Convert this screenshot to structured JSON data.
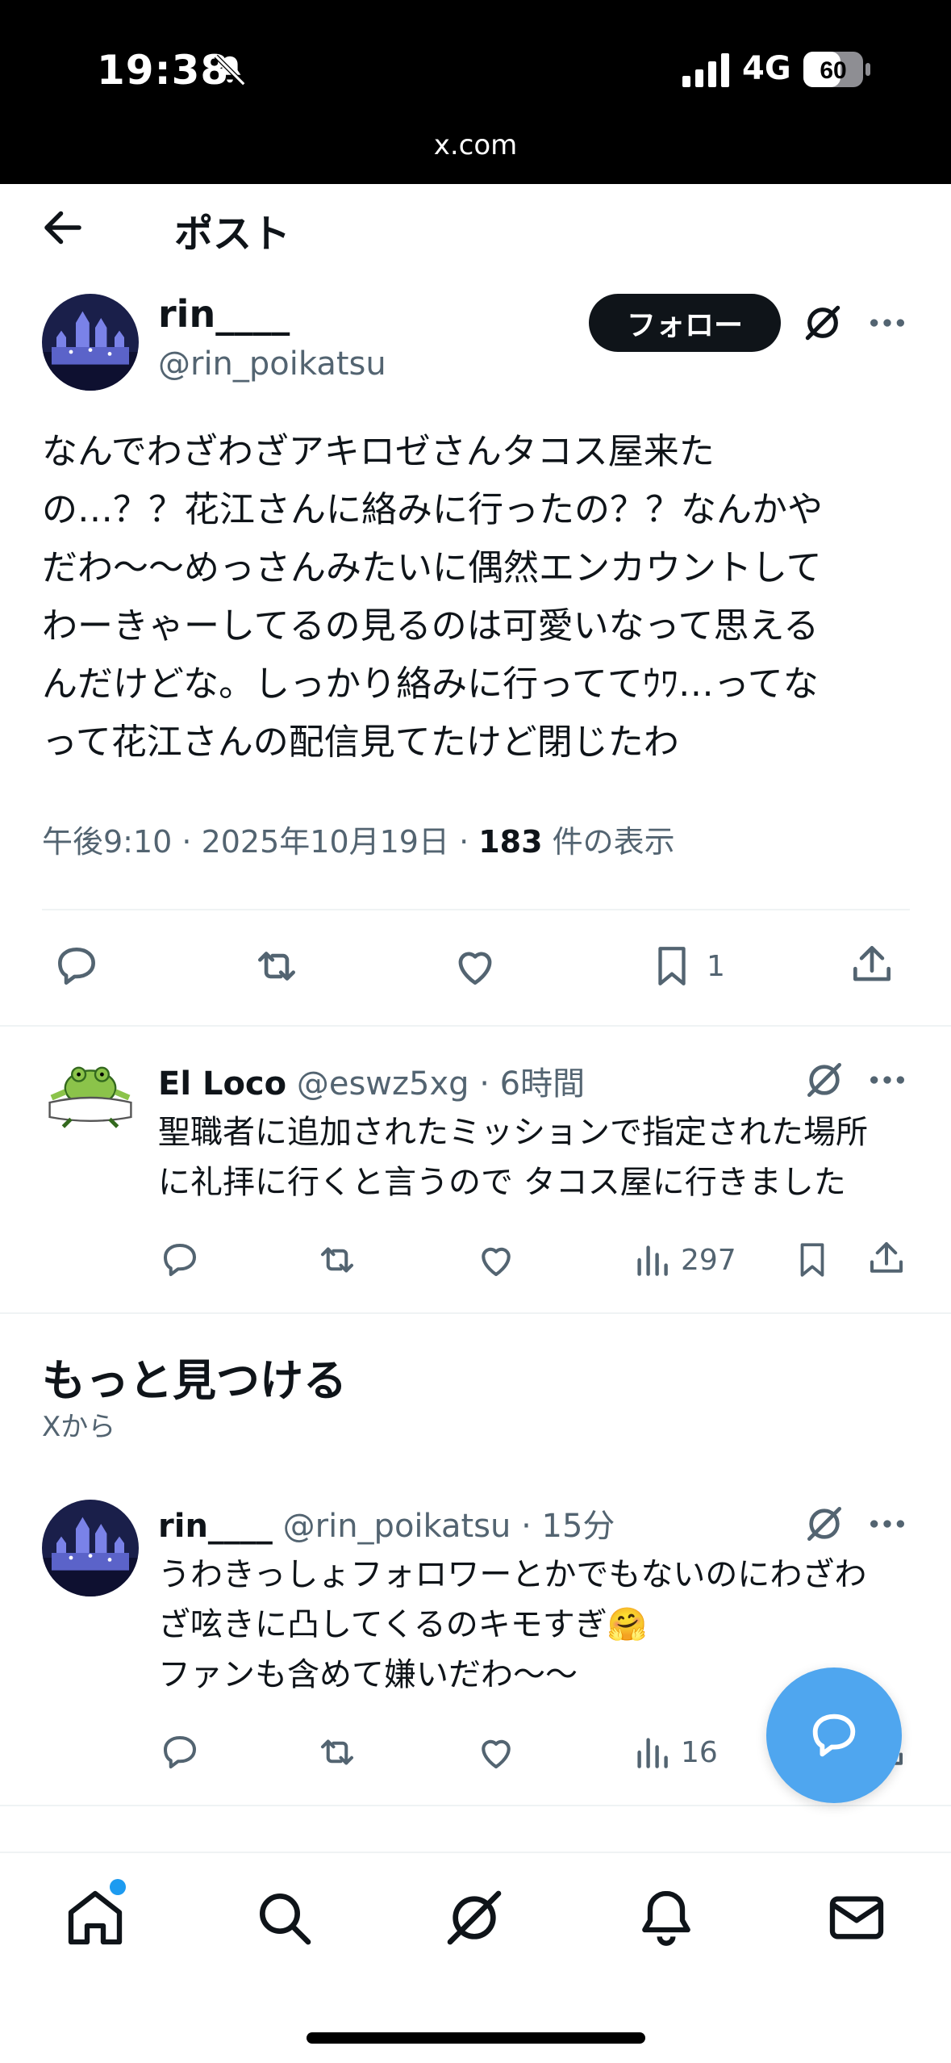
{
  "status_bar": {
    "time": "19:38",
    "network": "4G",
    "battery": "60",
    "url": "x.com"
  },
  "top_bar": {
    "title": "ポスト"
  },
  "main_post": {
    "name": "rin____",
    "handle": "@rin_poikatsu",
    "follow_label": "フォロー",
    "text": "なんでわざわざアキロゼさんタコス屋来た\nの…？？花江さんに絡みに行ったの？？なんかや\nだわ〜〜めっさんみたいに偶然エンカウントして\nわーきゃーしてるの見るのは可愛いなって思える\nんだけどな。しっかり絡みに行っててｳﾜ…ってな\nって花江さんの配信見てたけど閉じたわ",
    "time_date": "午後9:10 · 2025年10月19日 · ",
    "views": "183",
    "views_label": " 件の表示",
    "bookmarks": "1"
  },
  "reply": {
    "name": "El Loco",
    "handle_time": " @eswz5xg · 6時間",
    "text": "聖職者に追加されたミッションで指定された場所\nに礼拝に行くと言うので タコス屋に行きました",
    "views": "297"
  },
  "discover": {
    "title": "もっと見つける",
    "subtitle": "Xから"
  },
  "discover_post": {
    "name": "rin____",
    "handle_time": " @rin_poikatsu · 15分",
    "text": "うわきっしょフォロワーとかでもないのにわざわ\nざ呟きに凸してくるのキモすぎ🤗\nファンも含めて嫌いだわ〜〜",
    "views": "16"
  },
  "colors": {
    "accent": "#1d9bf0",
    "fab": "#4fa6ef",
    "text": "#0f1419",
    "muted": "#536471"
  },
  "icons": [
    "back-arrow-icon",
    "grok-icon",
    "more-icon",
    "reply-icon",
    "retweet-icon",
    "like-icon",
    "bookmark-icon",
    "share-icon",
    "views-icon",
    "compose-message-icon",
    "home-icon",
    "search-icon",
    "grok-tab-icon",
    "notifications-icon",
    "messages-icon"
  ]
}
